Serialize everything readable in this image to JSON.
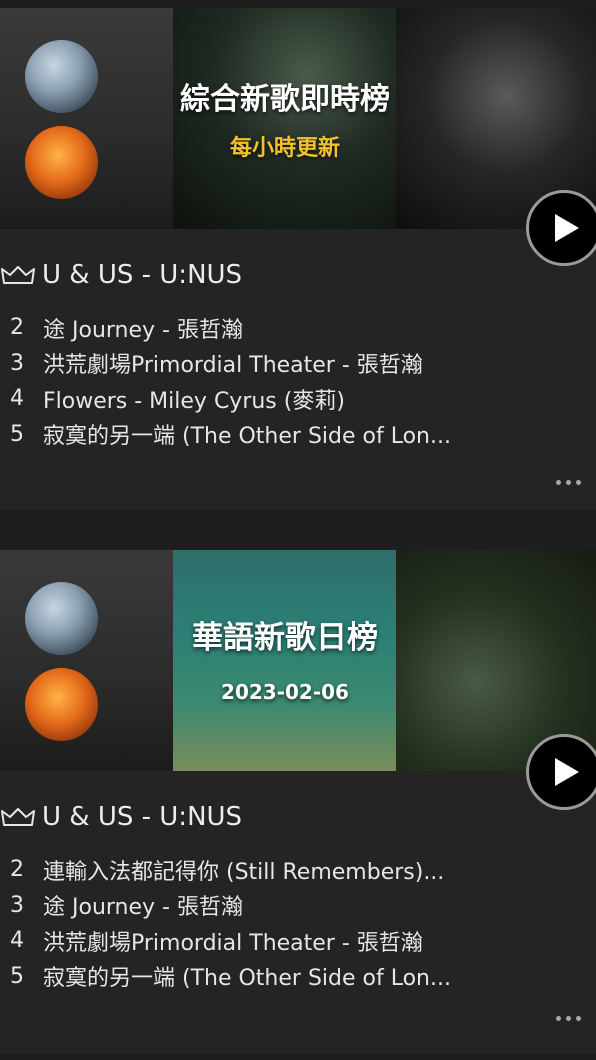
{
  "charts": [
    {
      "banner_title": "綜合新歌即時榜",
      "banner_subtitle": "每小時更新",
      "top_entry": "U & US - U:NUS",
      "entries": [
        {
          "rank": "2",
          "title": "途 Journey - 張哲瀚"
        },
        {
          "rank": "3",
          "title": "洪荒劇場Primordial Theater - 張哲瀚"
        },
        {
          "rank": "4",
          "title": "Flowers - Miley Cyrus (麥莉)"
        },
        {
          "rank": "5",
          "title": "寂寞的另一端 (The Other Side of Lon..."
        }
      ]
    },
    {
      "banner_title": "華語新歌日榜",
      "banner_subtitle": "2023-02-06",
      "top_entry": "U & US - U:NUS",
      "entries": [
        {
          "rank": "2",
          "title": "連輸入法都記得你 (Still Remembers)..."
        },
        {
          "rank": "3",
          "title": "途 Journey - 張哲瀚"
        },
        {
          "rank": "4",
          "title": "洪荒劇場Primordial Theater - 張哲瀚"
        },
        {
          "rank": "5",
          "title": "寂寞的另一端 (The Other Side of Lon..."
        }
      ]
    }
  ],
  "icons": {
    "crown": "crown-icon",
    "play": "play-icon",
    "more": "more-dots-icon"
  },
  "colors": {
    "background": "#1e1e1e",
    "card": "#242424",
    "subtitle_accent": "#f2c22c",
    "text": "#e8e8e8"
  }
}
